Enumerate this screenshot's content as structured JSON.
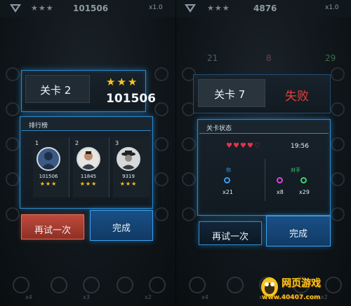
{
  "left": {
    "top_bar": {
      "stars": "★★★",
      "score": "101506",
      "multiplier": "x1.0"
    },
    "level_label": "关卡 2",
    "level_stars": "★★★",
    "level_score": "101506",
    "leaderboard": {
      "title": "排行榜",
      "entries": [
        {
          "rank": "1",
          "score": "101506",
          "stars": "★★★"
        },
        {
          "rank": "2",
          "score": "11845",
          "stars": "★★★"
        },
        {
          "rank": "3",
          "score": "9319",
          "stars": "★★★"
        }
      ]
    },
    "retry_label": "再试一次",
    "done_label": "完成",
    "bottom_counts": [
      "x4",
      "x3",
      "x2"
    ]
  },
  "right": {
    "top_bar": {
      "stars": "★★★",
      "score": "4876",
      "multiplier": "x1.0"
    },
    "bg_counts": [
      "21",
      "8",
      "29"
    ],
    "level_label": "关卡 7",
    "result_label": "失败",
    "status": {
      "title": "关卡状态",
      "hearts": "♥♥♥♥♡",
      "time": "19:56",
      "you_label": "你",
      "you_count": "x21",
      "opponent_label": "对手",
      "opponent_counts": [
        "x8",
        "x29"
      ]
    },
    "retry_label": "再试一次",
    "done_label": "完成",
    "bottom_counts": [
      "x4",
      "x3",
      "x2"
    ]
  },
  "watermark": {
    "brand": "网页游戏",
    "url": "www.40407.com"
  },
  "colors": {
    "accent_blue": "#2d87c8",
    "gold": "#f7c51c",
    "fail_red": "#e2413a",
    "heart_red": "#e8334a",
    "ring_blue": "#3aa0f0",
    "ring_magenta": "#d04ad8",
    "ring_green": "#3ad86a"
  }
}
